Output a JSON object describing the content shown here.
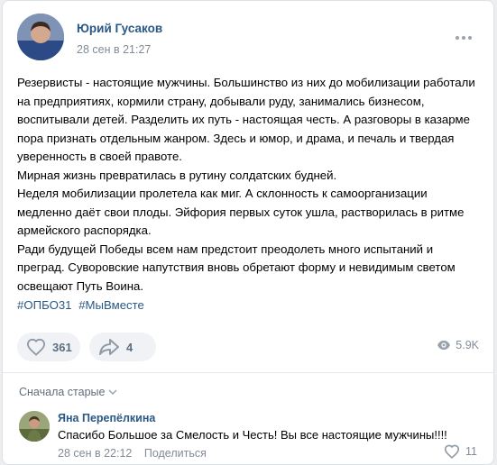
{
  "post": {
    "author": "Юрий Гусаков",
    "date": "28 сен в 21:27",
    "paragraphs": [
      "Резервисты - настоящие мужчины. Большинство из них до мобилизации работали на предприятиях, кормили страну, добывали руду, занимались бизнесом, воспитывали детей. Разделить их путь - настоящая честь. А разговоры в казарме пора признать отдельным жанром. Здесь и юмор, и драма, и печаль и твердая уверенность в своей правоте.",
      "Мирная жизнь превратилась в рутину солдатских будней.",
      "Неделя мобилизации пролетела как миг. А склонность к самоорганизации медленно даёт свои плоды. Эйфория первых суток ушла, растворилась в ритме армейского распорядка.",
      "Ради будущей Победы всем нам предстоит преодолеть много испытаний и преград. Суворовские напутствия вновь обретают форму и невидимым светом освещают Путь Воина."
    ],
    "hashtags": [
      "#ОПБО31",
      "#МыВместе"
    ],
    "likes": "361",
    "shares": "4",
    "views": "5.9K"
  },
  "comments_section": {
    "sort_label": "Сначала старые"
  },
  "comment": {
    "author": "Яна Перепёлкина",
    "text": "Спасибо Большое за Смелость и Честь! Вы все настоящие мужчины!!!!",
    "date": "28 сен в 22:12",
    "reply_label": "Поделиться",
    "likes": "11"
  },
  "icons": {
    "more": "more-horizontal-icon",
    "like": "heart-icon",
    "share": "share-arrow-icon",
    "views": "eye-icon",
    "sort": "chevron-down-icon"
  },
  "colors": {
    "link": "#2a5885",
    "secondary": "#818c99",
    "pill_bg": "#f0f2f5"
  }
}
